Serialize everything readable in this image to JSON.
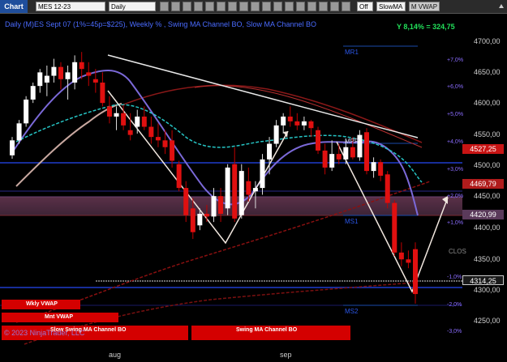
{
  "toolbar": {
    "chart_tab": "Chart",
    "instrument": "MES 12-23",
    "period": "Daily",
    "toggle_value": "Off",
    "strategy_value": "SlowMA",
    "indicator_label": "M VWAP"
  },
  "chart_title": "Daily (M)ES Sept 07 (1%=45p=$225), Weekly % , Swing MA Channel BO, Slow MA Channel BO",
  "readout": "Y 8,14% = 324,75",
  "copyright": "© 2023 NinjaTrader, LLC",
  "price_axis": [
    "4700,00",
    "4650,00",
    "4600,00",
    "4550,00",
    "4500,00",
    "4450,00",
    "4400,00",
    "4350,00",
    "4300,00",
    "4250,00"
  ],
  "pct_axis": [
    "+7,0%",
    "+6,0%",
    "+5,0%",
    "+4,0%",
    "+3,0%",
    "+2,0%",
    "+1,0%",
    "-1,0%",
    "-2,0%",
    "-3,0%"
  ],
  "price_boxes": [
    {
      "value": "4527,25",
      "color": "#c81414"
    },
    {
      "value": "4469,79",
      "color": "#b01c1c"
    },
    {
      "value": "4420,99",
      "color": "#5a3a5a"
    },
    {
      "value": "4314,25",
      "color": "#1a1a1a"
    }
  ],
  "levels": {
    "mr1": "MR1",
    "mpp": "MPP",
    "ms1": "MS1",
    "ms2": "MS2"
  },
  "clos": "CLOS",
  "dates": [
    "aug",
    "sep"
  ],
  "red_bars": {
    "wkly": "Wkly VWAP",
    "mnt": "Mnt VWAP",
    "slow": "Slow Swing MA Channel BO",
    "swing": "Swing MA Channel BO"
  },
  "chart_data": {
    "type": "candlestick",
    "title": "Daily (M)ES Sept 07 (1%=45p=$225), Weekly % , Swing MA Channel BO, Slow MA Channel BO",
    "ylim": [
      4220,
      4725
    ],
    "x": [
      "aug",
      "sep"
    ],
    "candles": [
      {
        "o": 4518,
        "h": 4545,
        "l": 4513,
        "c": 4540
      },
      {
        "o": 4540,
        "h": 4570,
        "l": 4535,
        "c": 4565
      },
      {
        "o": 4565,
        "h": 4605,
        "l": 4560,
        "c": 4600
      },
      {
        "o": 4600,
        "h": 4625,
        "l": 4595,
        "c": 4620
      },
      {
        "o": 4620,
        "h": 4645,
        "l": 4610,
        "c": 4640
      },
      {
        "o": 4625,
        "h": 4650,
        "l": 4605,
        "c": 4635
      },
      {
        "o": 4635,
        "h": 4660,
        "l": 4625,
        "c": 4648
      },
      {
        "o": 4648,
        "h": 4655,
        "l": 4615,
        "c": 4630
      },
      {
        "o": 4630,
        "h": 4650,
        "l": 4600,
        "c": 4640
      },
      {
        "o": 4625,
        "h": 4665,
        "l": 4615,
        "c": 4655
      },
      {
        "o": 4655,
        "h": 4670,
        "l": 4630,
        "c": 4645
      },
      {
        "o": 4640,
        "h": 4655,
        "l": 4620,
        "c": 4635
      },
      {
        "o": 4630,
        "h": 4645,
        "l": 4610,
        "c": 4625
      },
      {
        "o": 4625,
        "h": 4640,
        "l": 4590,
        "c": 4595
      },
      {
        "o": 4590,
        "h": 4605,
        "l": 4565,
        "c": 4575
      },
      {
        "o": 4575,
        "h": 4590,
        "l": 4555,
        "c": 4580
      },
      {
        "o": 4580,
        "h": 4592,
        "l": 4555,
        "c": 4562
      },
      {
        "o": 4555,
        "h": 4580,
        "l": 4540,
        "c": 4548
      },
      {
        "o": 4560,
        "h": 4585,
        "l": 4550,
        "c": 4575
      },
      {
        "o": 4575,
        "h": 4590,
        "l": 4555,
        "c": 4560
      },
      {
        "o": 4560,
        "h": 4575,
        "l": 4535,
        "c": 4545
      },
      {
        "o": 4545,
        "h": 4565,
        "l": 4530,
        "c": 4540
      },
      {
        "o": 4540,
        "h": 4555,
        "l": 4520,
        "c": 4530
      },
      {
        "o": 4540,
        "h": 4555,
        "l": 4500,
        "c": 4510
      },
      {
        "o": 4505,
        "h": 4510,
        "l": 4465,
        "c": 4470
      },
      {
        "o": 4470,
        "h": 4480,
        "l": 4420,
        "c": 4430
      },
      {
        "o": 4440,
        "h": 4455,
        "l": 4395,
        "c": 4405
      },
      {
        "o": 4415,
        "h": 4440,
        "l": 4408,
        "c": 4432
      },
      {
        "o": 4432,
        "h": 4445,
        "l": 4420,
        "c": 4428
      },
      {
        "o": 4428,
        "h": 4470,
        "l": 4420,
        "c": 4458
      },
      {
        "o": 4458,
        "h": 4470,
        "l": 4420,
        "c": 4432
      },
      {
        "o": 4440,
        "h": 4505,
        "l": 4430,
        "c": 4500
      },
      {
        "o": 4505,
        "h": 4530,
        "l": 4420,
        "c": 4425
      },
      {
        "o": 4430,
        "h": 4505,
        "l": 4425,
        "c": 4495
      },
      {
        "o": 4480,
        "h": 4500,
        "l": 4450,
        "c": 4460
      },
      {
        "o": 4465,
        "h": 4480,
        "l": 4440,
        "c": 4470
      },
      {
        "o": 4470,
        "h": 4520,
        "l": 4460,
        "c": 4512
      },
      {
        "o": 4512,
        "h": 4545,
        "l": 4490,
        "c": 4535
      },
      {
        "o": 4535,
        "h": 4570,
        "l": 4530,
        "c": 4562
      },
      {
        "o": 4562,
        "h": 4580,
        "l": 4550,
        "c": 4575
      },
      {
        "o": 4575,
        "h": 4590,
        "l": 4560,
        "c": 4568
      },
      {
        "o": 4568,
        "h": 4580,
        "l": 4555,
        "c": 4562
      },
      {
        "o": 4562,
        "h": 4575,
        "l": 4555,
        "c": 4568
      },
      {
        "o": 4568,
        "h": 4570,
        "l": 4545,
        "c": 4558
      },
      {
        "o": 4555,
        "h": 4560,
        "l": 4520,
        "c": 4525
      },
      {
        "o": 4525,
        "h": 4535,
        "l": 4490,
        "c": 4500
      },
      {
        "o": 4500,
        "h": 4540,
        "l": 4495,
        "c": 4520
      },
      {
        "o": 4520,
        "h": 4535,
        "l": 4505,
        "c": 4512
      },
      {
        "o": 4512,
        "h": 4540,
        "l": 4505,
        "c": 4530
      },
      {
        "o": 4530,
        "h": 4545,
        "l": 4512,
        "c": 4515
      },
      {
        "o": 4515,
        "h": 4555,
        "l": 4510,
        "c": 4548
      },
      {
        "o": 4552,
        "h": 4558,
        "l": 4490,
        "c": 4495
      },
      {
        "o": 4495,
        "h": 4515,
        "l": 4485,
        "c": 4508
      },
      {
        "o": 4508,
        "h": 4512,
        "l": 4480,
        "c": 4488
      },
      {
        "o": 4490,
        "h": 4495,
        "l": 4440,
        "c": 4448
      },
      {
        "o": 4448,
        "h": 4452,
        "l": 4370,
        "c": 4375
      },
      {
        "o": 4375,
        "h": 4390,
        "l": 4355,
        "c": 4365
      },
      {
        "o": 4365,
        "h": 4378,
        "l": 4352,
        "c": 4360
      },
      {
        "o": 4380,
        "h": 4390,
        "l": 4300,
        "c": 4314
      }
    ],
    "levels": {
      "MR1": 4690,
      "MPP": 4532,
      "MS1": 4413,
      "MS2": 4302
    },
    "last_price": 4314.25
  }
}
